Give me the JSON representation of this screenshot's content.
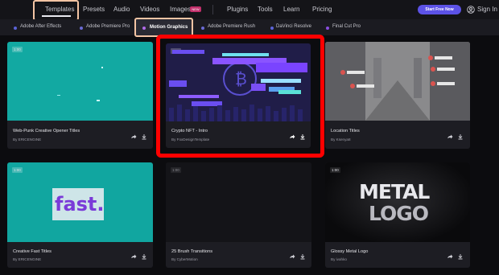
{
  "nav": {
    "items": [
      "Templates",
      "Presets",
      "Audio",
      "Videos",
      "Images",
      "Plugins",
      "Tools",
      "Learn",
      "Pricing"
    ],
    "new_badge": "NEW",
    "cta": "Start Free Now",
    "sign_in": "Sign In"
  },
  "categories": [
    {
      "label": "Adobe After Effects",
      "color": "#5b63d8"
    },
    {
      "label": "Adobe Premiere Pro",
      "color": "#6b6bd6"
    },
    {
      "label": "Motion Graphics",
      "color": "#b26bea"
    },
    {
      "label": "Adobe Premiere Rush",
      "color": "#6b6bd6"
    },
    {
      "label": "DaVinci Resolve",
      "color": "#5b63d8"
    },
    {
      "label": "Final Cut Pro",
      "color": "#8a4ee0"
    }
  ],
  "cards": [
    {
      "title": "Web-Punk Creative Opener Titles",
      "author": "By ERICENGINE",
      "ratio": "1:00"
    },
    {
      "title": "Crypto NFT - Intro",
      "author": "By FoxDesignTemplate",
      "ratio": "1:00"
    },
    {
      "title": "Location Titles",
      "author": "By Ksenya8",
      "ratio": "1:00"
    },
    {
      "title": "Creative Fast Titles",
      "author": "By ERICENGINE",
      "ratio": "1:00",
      "thumb_text": "fast."
    },
    {
      "title": "25 Brush Transitions",
      "author": "By CyberMotion",
      "ratio": "1:00"
    },
    {
      "title": "Glossy Metal Logo",
      "author": "By ivahko",
      "ratio": "1:00",
      "thumb_text_1": "METAL",
      "thumb_text_2": "LOGO"
    }
  ]
}
